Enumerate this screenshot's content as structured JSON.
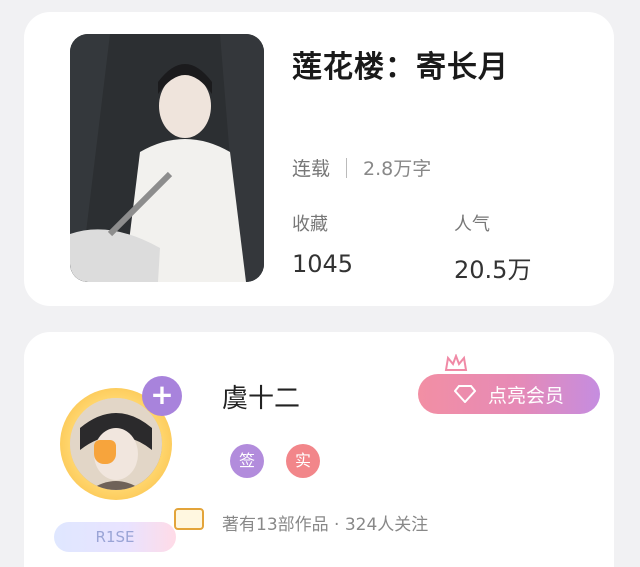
{
  "book": {
    "title": "莲花楼：寄长月",
    "status": "连载",
    "word_count": "2.8万字",
    "favorites_label": "收藏",
    "favorites_value": "1045",
    "popularity_label": "人气",
    "popularity_value": "20.5万",
    "cover_icon": "book-cover-image"
  },
  "author": {
    "name": "虞十二",
    "tag_sign": "签",
    "tag_real": "实",
    "meta": "著有13部作品 · 324人关注",
    "badge_text": "R1SE",
    "add_icon": "+",
    "vip_button": "点亮会员",
    "avatar_icon": "author-avatar"
  },
  "colors": {
    "background": "#f1f1f3",
    "card": "#ffffff",
    "accent_purple": "#a883dc",
    "accent_pink": "#f28fa4"
  }
}
